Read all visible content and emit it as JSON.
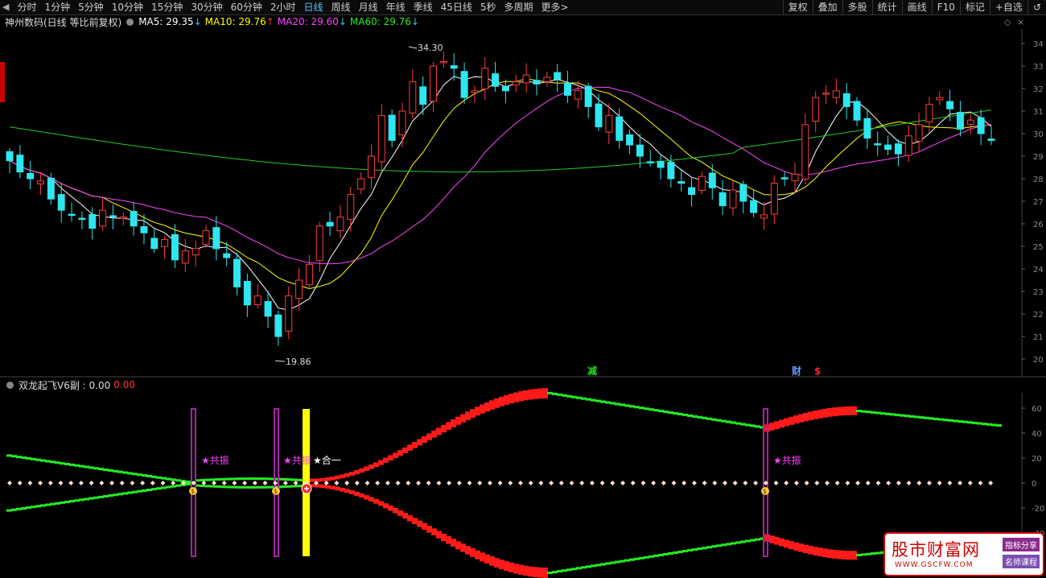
{
  "toolbar": {
    "period_tabs": [
      "分时",
      "1分钟",
      "5分钟",
      "10分钟",
      "15分钟",
      "30分钟",
      "60分钟",
      "2小时",
      "日线",
      "周线",
      "月线",
      "年线",
      "季线",
      "45日线",
      "5秒",
      "多周期",
      "更多>"
    ],
    "active_tab": "日线",
    "right_tabs": [
      "复权",
      "叠加",
      "多股",
      "统计",
      "画线",
      "F10",
      "标记",
      "+自选",
      "↺"
    ]
  },
  "main_panel": {
    "title": "神州数码(日线 等比前复权)",
    "ma": [
      {
        "label": "MA5: 29.35",
        "arrow": "↓",
        "color": "#ffffff"
      },
      {
        "label": "MA10: 29.76",
        "arrow": "↑",
        "color": "#ffff00"
      },
      {
        "label": "MA20: 29.60",
        "arrow": "↓",
        "color": "#ff44ff"
      },
      {
        "label": "MA60: 29.76",
        "arrow": "↓",
        "color": "#22ee22"
      }
    ],
    "high_label": "34.30",
    "low_label": "19.86",
    "y_ticks": [
      "34",
      "33",
      "32",
      "31",
      "30",
      "29",
      "28",
      "27",
      "26",
      "25",
      "24",
      "23",
      "22",
      "21",
      "20"
    ],
    "markers": [
      {
        "text": "减",
        "color": "#22dd22"
      },
      {
        "text": "财",
        "color": "#6699ff"
      },
      {
        "text": "$",
        "color": "#ff2222"
      }
    ]
  },
  "indicator_panel": {
    "title": "双龙起飞V6副 : 0.00",
    "value2": "0.00",
    "y_ticks": [
      "60",
      "40",
      "20",
      "0",
      "-20",
      "-40"
    ],
    "labels": [
      "★共振",
      "★共振",
      "★合一",
      "★共振"
    ]
  },
  "logo": {
    "name": "股市财富网",
    "url": "WWW.GSCFW.COM",
    "badge1": "指标分享",
    "badge2": "名师课程"
  }
}
